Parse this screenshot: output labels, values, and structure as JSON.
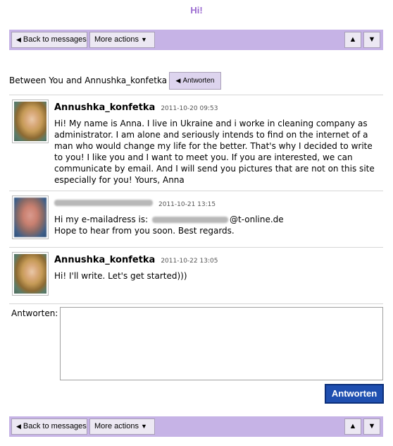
{
  "page": {
    "title": "Hi!"
  },
  "toolbar": {
    "back_label": "Back to messages",
    "more_label": "More actions",
    "up_label": "▲",
    "down_label": "▼"
  },
  "conversation": {
    "between_text": "Between You and Annushka_konfetka",
    "reply_button_label": "Antworten"
  },
  "messages": [
    {
      "sender": "Annushka_konfetka",
      "date": "2011-10-20 09:53",
      "text": "Hi! My name is Anna. I live in Ukraine and i worke in cleaning company as administrator. I am alone and seriously intends to find on the internet of a man who would change my life for the better. That's why I decided to write to you! I like you and I want to meet you. If you are interested, we can communicate by email. And I will send you pictures that are not on this site especially for you! Yours, Anna"
    },
    {
      "sender": "",
      "date": "2011-10-21 13:15",
      "text_prefix": "Hi my e-mailadress is:",
      "text_suffix": "@t-online.de",
      "text_line2": "Hope to hear from you soon. Best regards."
    },
    {
      "sender": "Annushka_konfetka",
      "date": "2011-10-22 13:05",
      "text": "Hi! I'll write. Let's get started)))"
    }
  ],
  "reply": {
    "label": "Antworten:",
    "value": "",
    "send_label": "Antworten"
  },
  "colors": {
    "toolbar_bg": "#c6b3e6",
    "title_color": "#9b6bd0",
    "send_button_bg": "#1f4fb0"
  },
  "icons": {
    "back": "triangle-left-icon",
    "more": "triangle-down-icon",
    "up": "arrow-up-icon",
    "down": "arrow-down-icon"
  }
}
